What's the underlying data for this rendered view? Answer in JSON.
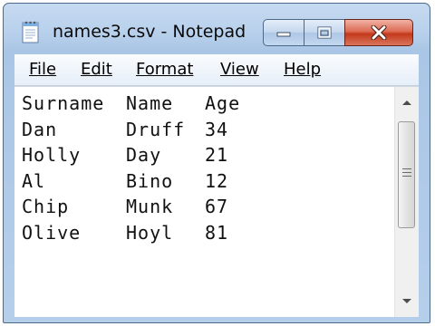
{
  "window": {
    "title": "names3.csv - Notepad"
  },
  "menu": [
    "File",
    "Edit",
    "Format",
    "View",
    "Help"
  ],
  "file_lines": [
    [
      "Surname",
      "Name",
      "Age"
    ],
    [
      "Dan",
      "Druff",
      "34"
    ],
    [
      "Holly",
      "Day",
      "21"
    ],
    [
      "Al",
      "Bino",
      "12"
    ],
    [
      "Chip",
      "Munk",
      "67"
    ],
    [
      "Olive",
      "Hoyl",
      "81"
    ]
  ],
  "icons": {
    "app": "notepad-icon",
    "minimize": "minimize-icon",
    "maximize": "maximize-icon",
    "close": "close-icon",
    "scroll_up": "scroll-up-arrow-icon",
    "scroll_down": "scroll-down-arrow-icon",
    "thumb_grip": "grip-icon"
  },
  "colors": {
    "frame": "#b9d1ec",
    "close_button": "#c4391c"
  },
  "scroll": {
    "thumb_fraction": 0.5
  }
}
